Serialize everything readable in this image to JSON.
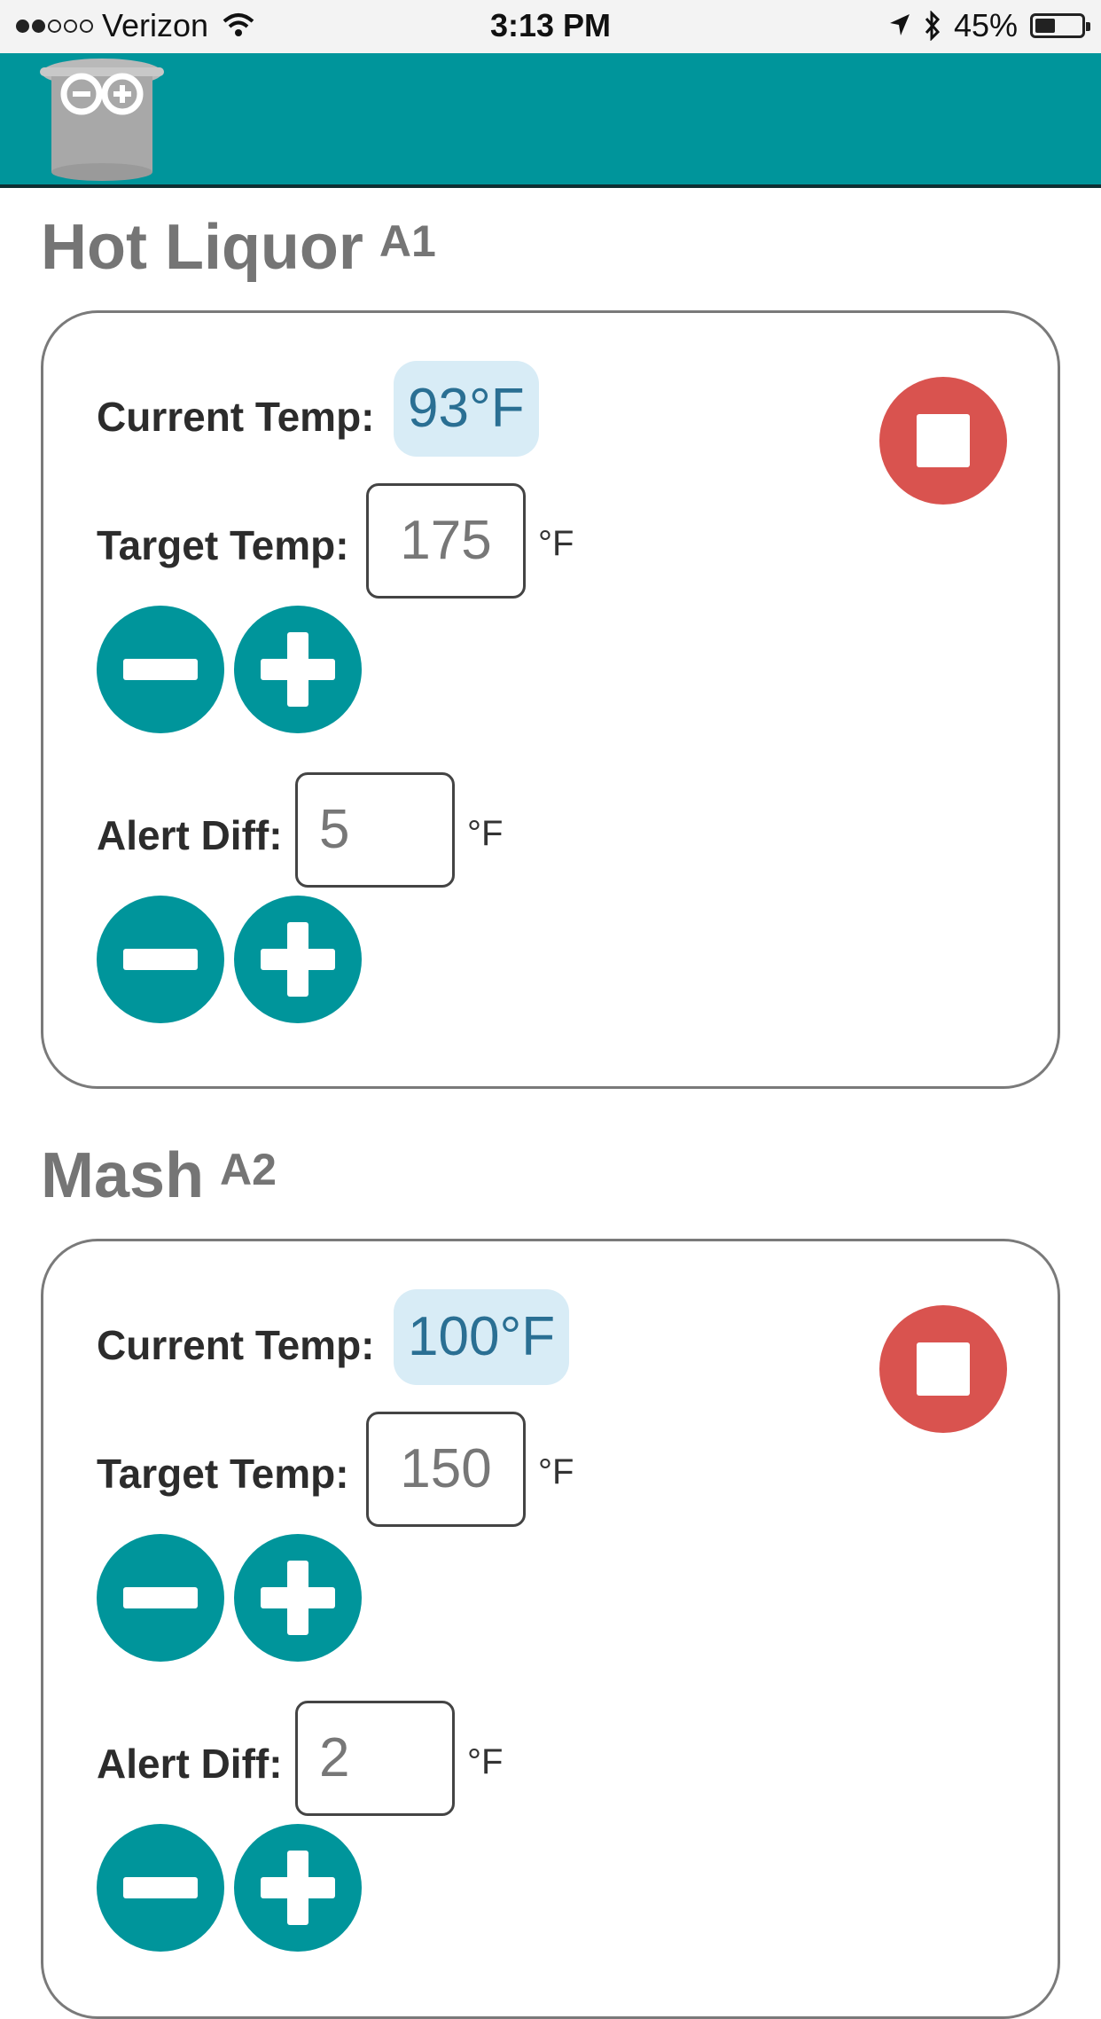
{
  "status_bar": {
    "carrier": "Verizon",
    "time": "3:13 PM",
    "battery": "45%"
  },
  "header": {
    "logo_icon": "pot-logo-icon"
  },
  "units": "°F",
  "controls": {
    "current_temp_label": "Current Temp:",
    "target_temp_label": "Target Temp:",
    "alert_diff_label": "Alert Diff:"
  },
  "sections": [
    {
      "title": "Hot Liquor",
      "pin": "A1",
      "current_temp": "93°F",
      "target_temp": "175",
      "alert_diff": "5"
    },
    {
      "title": "Mash",
      "pin": "A2",
      "current_temp": "100°F",
      "target_temp": "150",
      "alert_diff": "2"
    }
  ],
  "colors": {
    "accent": "#00959b",
    "stop": "#d9534f",
    "badge_bg": "#d8ecf6",
    "badge_text": "#2a6f93"
  }
}
